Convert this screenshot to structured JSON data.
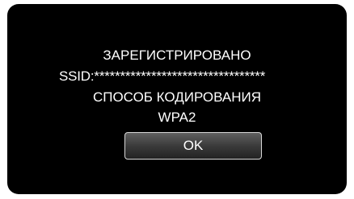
{
  "dialog": {
    "status": "ЗАРЕГИСТРИРОВАНО",
    "ssid_line": "SSID:*********************************",
    "encryption_label": "СПОСОБ КОДИРОВАНИЯ",
    "encryption_value": "WPA2",
    "ok_label": "OK"
  },
  "colors": {
    "screen_background": "#000000",
    "text": "#ffffff",
    "button_border": "#d8d8d8"
  }
}
